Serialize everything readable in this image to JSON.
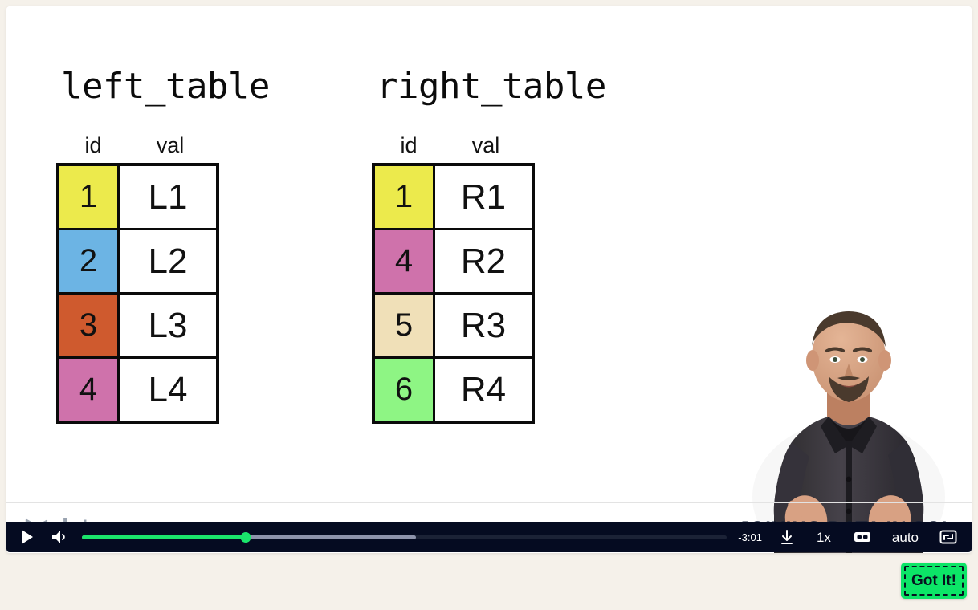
{
  "slide": {
    "left_table": {
      "title": "left_table",
      "headers": [
        "id",
        "val"
      ],
      "rows": [
        {
          "id": "1",
          "val": "L1",
          "color": "#ecea4c"
        },
        {
          "id": "2",
          "val": "L2",
          "color": "#6cb4e4"
        },
        {
          "id": "3",
          "val": "L3",
          "color": "#cf5a2e"
        },
        {
          "id": "4",
          "val": "L4",
          "color": "#cf72ab"
        }
      ]
    },
    "right_table": {
      "title": "right_table",
      "headers": [
        "id",
        "val"
      ],
      "rows": [
        {
          "id": "1",
          "val": "R1",
          "color": "#ecea4c"
        },
        {
          "id": "4",
          "val": "R2",
          "color": "#cf72ab"
        },
        {
          "id": "5",
          "val": "R3",
          "color": "#f0e0b8"
        },
        {
          "id": "6",
          "val": "R4",
          "color": "#8ef584"
        }
      ]
    },
    "footer": {
      "logo_text": "datacamp",
      "course_title": "JOINING DATA IN SQL"
    }
  },
  "player": {
    "play_label": "play-icon",
    "volume_label": "volume-icon",
    "time_remaining": "-3:01",
    "speed_label": "1x",
    "quality_label": "auto",
    "captions_label": "CC",
    "download_label": "download-icon",
    "fullscreen_label": "fullscreen-icon",
    "progress": {
      "played_percent": 25.4,
      "buffered_percent": 51.8,
      "played_color": "#1ae56b",
      "buffered_color": "#8d93ab",
      "track_color": "#1b2236"
    }
  },
  "overlay": {
    "got_it_label": "Got It!",
    "got_it_color": "#0ce567"
  }
}
